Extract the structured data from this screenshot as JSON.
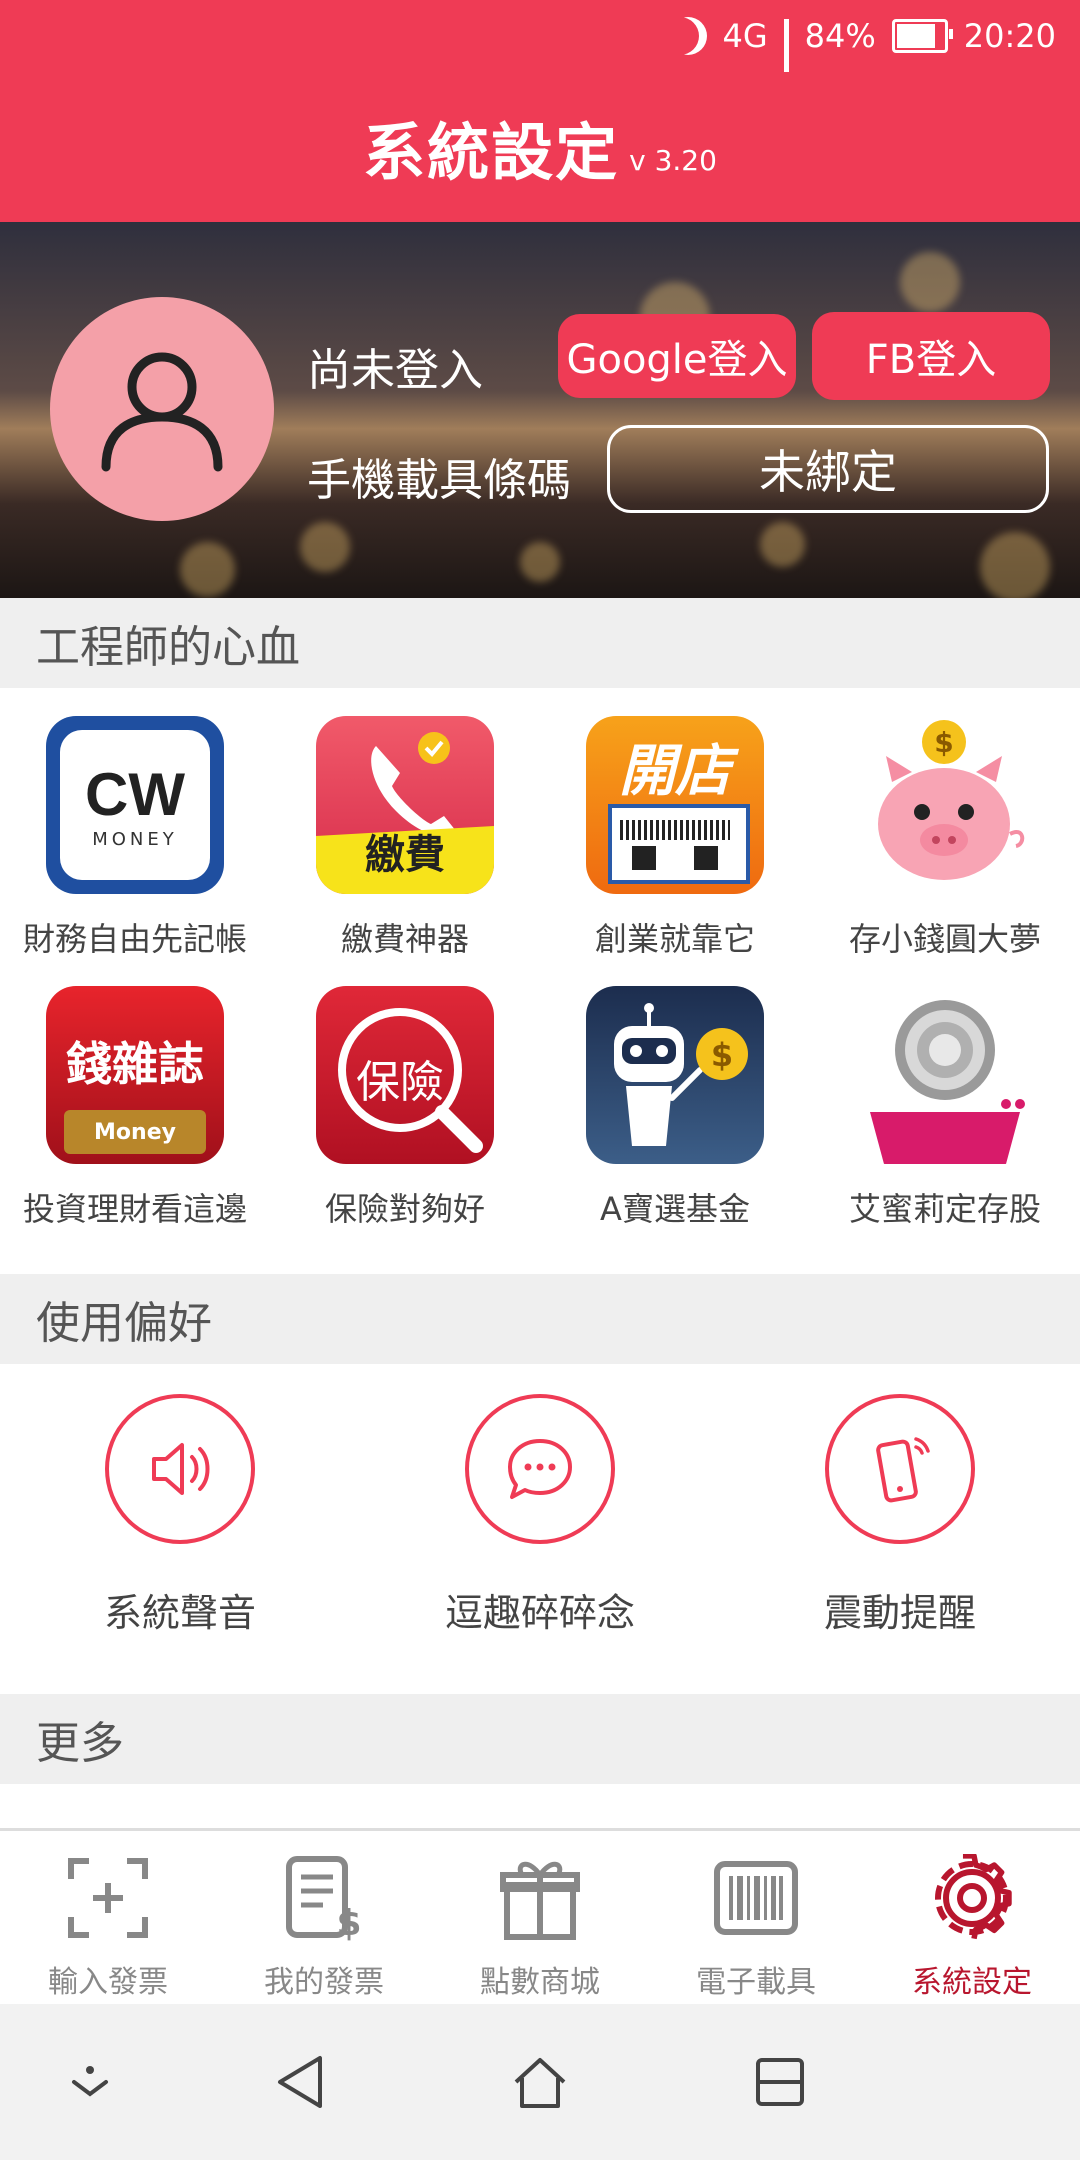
{
  "status_bar": {
    "network": "4G",
    "battery_percent": "84%",
    "battery_level": 0.84,
    "time": "20:20",
    "icons": [
      "moon-alarm-icon",
      "network-4g-icon",
      "signal-icon",
      "battery-icon"
    ]
  },
  "header": {
    "title": "系統設定",
    "version": "v 3.20"
  },
  "profile": {
    "login_status": "尚未登入",
    "google_login_label": "Google登入",
    "fb_login_label": "FB登入",
    "barcode_label": "手機載具條碼",
    "barcode_status": "未綁定",
    "avatar_icon": "user-icon"
  },
  "sections": {
    "apps_title": "工程師的心血",
    "prefs_title": "使用偏好",
    "more_title": "更多"
  },
  "apps": [
    {
      "label": "財務自由先記帳",
      "icon": "cw-money-icon",
      "icon_text": "CW",
      "sub_text": "MONEY"
    },
    {
      "label": "繳費神器",
      "icon": "payment-phone-icon",
      "icon_text": "繳費"
    },
    {
      "label": "創業就靠它",
      "icon": "open-store-icon",
      "icon_text": "開店"
    },
    {
      "label": "存小錢圓大夢",
      "icon": "piggy-bank-icon",
      "icon_text": "$"
    },
    {
      "label": "投資理財看這邊",
      "icon": "money-magazine-icon",
      "icon_text": "錢雜誌",
      "sub_text": "Money"
    },
    {
      "label": "保險對夠好",
      "icon": "insurance-search-icon",
      "icon_text": "保險"
    },
    {
      "label": "A寶選基金",
      "icon": "robot-fund-icon",
      "icon_text": "$"
    },
    {
      "label": "艾蜜莉定存股",
      "icon": "safe-dial-icon"
    }
  ],
  "preferences": [
    {
      "label": "系統聲音",
      "icon": "speaker-icon"
    },
    {
      "label": "逗趣碎碎念",
      "icon": "chat-bubble-icon"
    },
    {
      "label": "震動提醒",
      "icon": "vibrate-phone-icon"
    }
  ],
  "tabs": [
    {
      "label": "輸入發票",
      "icon": "scan-add-icon",
      "active": false
    },
    {
      "label": "我的發票",
      "icon": "receipt-dollar-icon",
      "active": false
    },
    {
      "label": "點數商城",
      "icon": "gift-icon",
      "active": false
    },
    {
      "label": "電子載具",
      "icon": "barcode-icon",
      "active": false
    },
    {
      "label": "系統設定",
      "icon": "gear-icon",
      "active": true
    }
  ],
  "nav": {
    "buttons": [
      "collapse-icon",
      "back-icon",
      "home-icon",
      "recents-icon"
    ]
  },
  "colors": {
    "brand": "#ef3b55",
    "active_tab": "#b8162e",
    "inactive": "#888888"
  }
}
